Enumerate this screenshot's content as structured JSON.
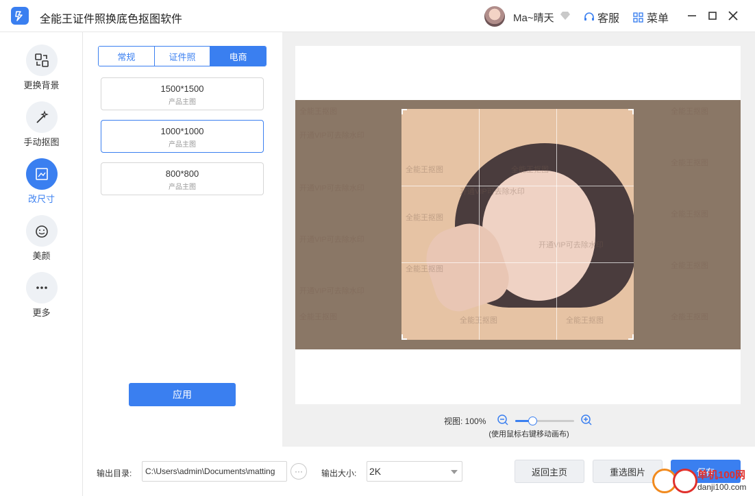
{
  "app": {
    "title": "全能王证件照换底色抠图软件",
    "user": "Ma~晴天",
    "service": "客服",
    "menu": "菜单"
  },
  "sidebar": {
    "items": [
      {
        "label": "更换背景",
        "icon": "swap-icon"
      },
      {
        "label": "手动抠图",
        "icon": "magic-wand-icon"
      },
      {
        "label": "改尺寸",
        "icon": "resize-icon",
        "active": true
      },
      {
        "label": "美颜",
        "icon": "smile-icon"
      },
      {
        "label": "更多",
        "icon": "more-icon"
      }
    ]
  },
  "panel": {
    "tabs": [
      {
        "label": "常规"
      },
      {
        "label": "证件照"
      },
      {
        "label": "电商",
        "active": true
      }
    ],
    "sizes": [
      {
        "value": "1500*1500",
        "sub": "产品主图"
      },
      {
        "value": "1000*1000",
        "sub": "产品主图",
        "selected": true
      },
      {
        "value": "800*800",
        "sub": "产品主图"
      }
    ],
    "apply_label": "应用"
  },
  "canvas": {
    "watermarks": [
      "全能王抠图",
      "开通VIP可去除水印"
    ]
  },
  "zoom": {
    "label": "视图: 100%",
    "level": 0.3,
    "hint": "(使用鼠标右键移动画布)"
  },
  "bottom": {
    "out_dir_label": "输出目录:",
    "out_dir_value": "C:\\Users\\admin\\Documents\\matting",
    "browse": "···",
    "out_size_label": "输出大小:",
    "out_size_value": "2K",
    "home_label": "返回主页",
    "reselect_label": "重选图片",
    "save_label": "保存"
  },
  "site": {
    "brand": "单机100网",
    "url": "danji100.com"
  },
  "colors": {
    "accent": "#3a7ff0"
  }
}
